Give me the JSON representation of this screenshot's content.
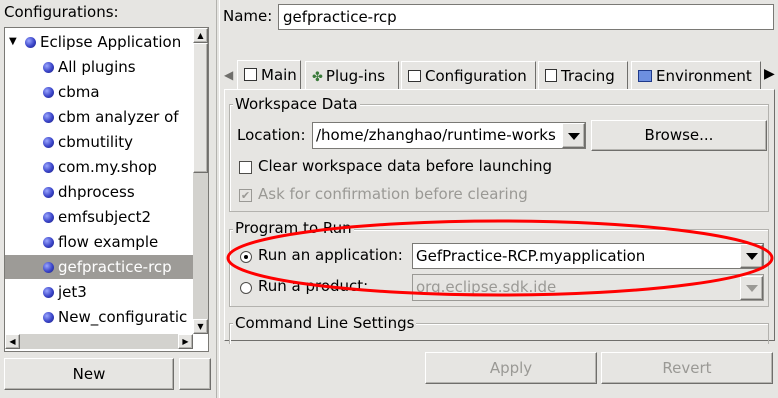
{
  "left": {
    "title": "Configurations:",
    "root": "Eclipse Application",
    "items": [
      "All plugins",
      "cbma",
      "cbm analyzer of",
      "cbmutility",
      "com.my.shop",
      "dhprocess",
      "emfsubject2",
      "flow example",
      "gefpractice-rcp",
      "jet3",
      "New_configuratic"
    ],
    "new_button": "New"
  },
  "name_label": "Name:",
  "name_value": "gefpractice-rcp",
  "tabs": [
    "Main",
    "Plug-ins",
    "Configuration",
    "Tracing",
    "Environment"
  ],
  "workspace": {
    "title": "Workspace Data",
    "location_label": "Location:",
    "location_value": "/home/zhanghao/runtime-works",
    "browse": "Browse...",
    "clear_label": "Clear workspace data before launching",
    "ask_label": "Ask for confirmation before clearing"
  },
  "program": {
    "title": "Program to Run",
    "run_app_label": "Run an application:",
    "app_value": "GefPractice-RCP.myapplication",
    "run_product_label": "Run a product:",
    "product_value": "org.eclipse.sdk.ide"
  },
  "cmdline_title": "Command Line Settings",
  "apply": "Apply",
  "revert": "Revert",
  "colors": {
    "selected_row": "#9d9b97",
    "highlight_ellipse": "#ff0000"
  }
}
